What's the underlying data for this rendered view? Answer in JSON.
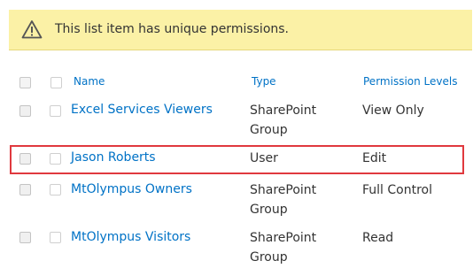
{
  "banner": {
    "icon": "warning-triangle-icon",
    "message": "This list item has unique permissions."
  },
  "table": {
    "headers": {
      "name": "Name",
      "type": "Type",
      "permission_levels": "Permission Levels"
    },
    "rows": [
      {
        "name": "Excel Services Viewers",
        "type_line1": "SharePoint",
        "type_line2": "Group",
        "permission": "View Only"
      },
      {
        "name": "Jason Roberts",
        "type_line1": "User",
        "type_line2": "",
        "permission": "Edit"
      },
      {
        "name": "MtOlympus Owners",
        "type_line1": "SharePoint",
        "type_line2": "Group",
        "permission": "Full Control"
      },
      {
        "name": "MtOlympus Visitors",
        "type_line1": "SharePoint",
        "type_line2": "Group",
        "permission": "Read"
      }
    ]
  },
  "colors": {
    "banner_bg": "#fbf1a6",
    "link": "#0072c6",
    "highlight": "#e0393e"
  }
}
